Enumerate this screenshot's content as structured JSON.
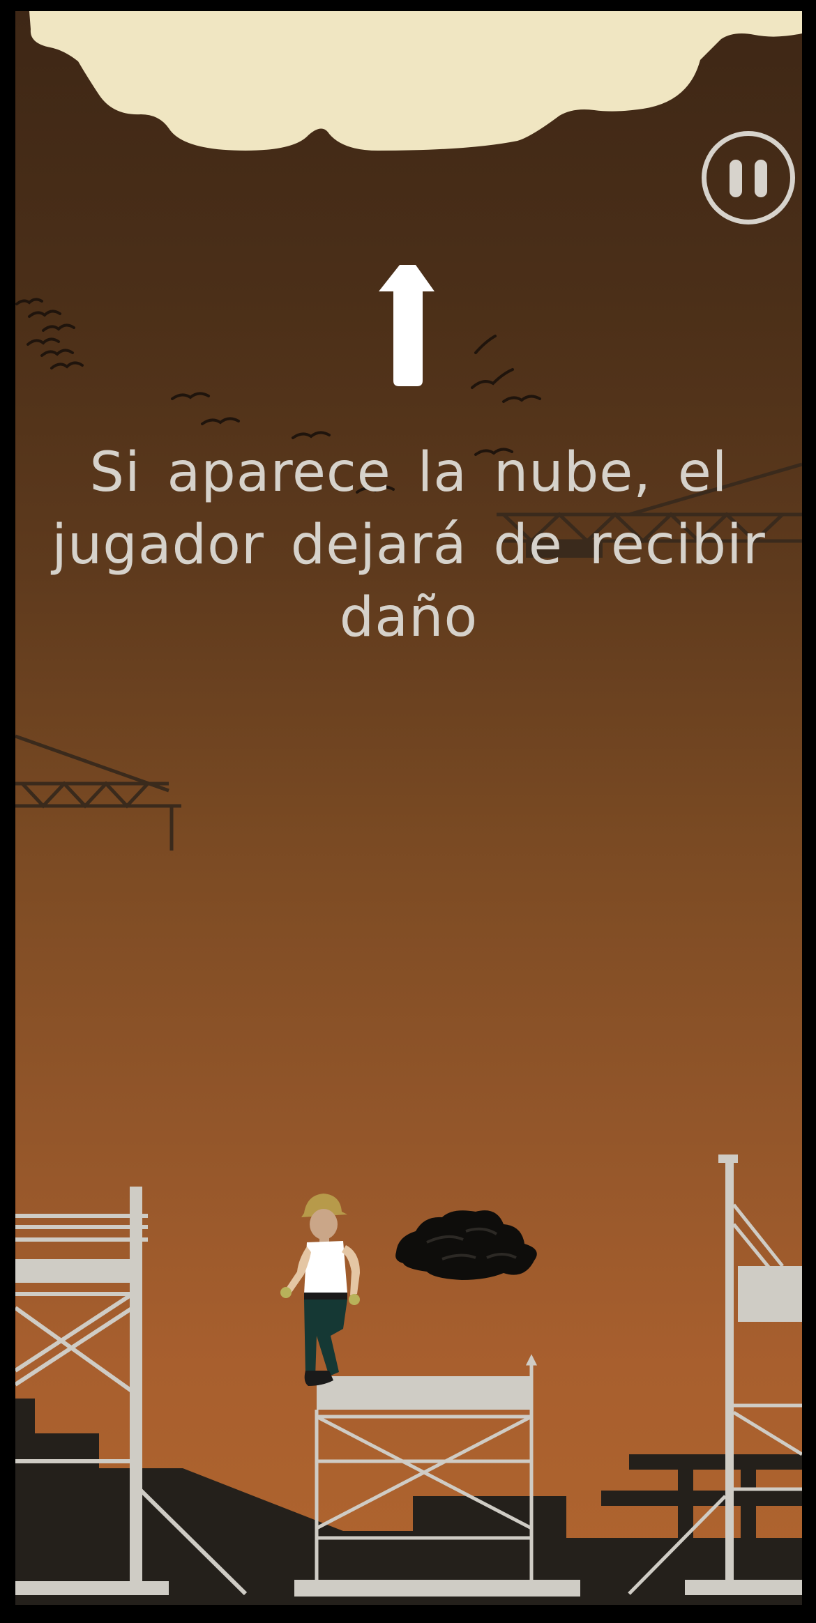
{
  "game": {
    "hint_text": "Si aparece la nube, el jugador dejará de recibir daño",
    "pause_icon": "pause-icon",
    "cloud_icon": "cloud",
    "arrow_icon": "arrow-up-icon",
    "colors": {
      "sky_top": "#3e2716",
      "sky_bottom": "#b0652f",
      "cloud": "#f0e6c2",
      "text": "#d6d2cb",
      "scaffold": "#cfccc5",
      "ground": "#24201b",
      "storm_cloud": "#0e0d0b"
    }
  }
}
